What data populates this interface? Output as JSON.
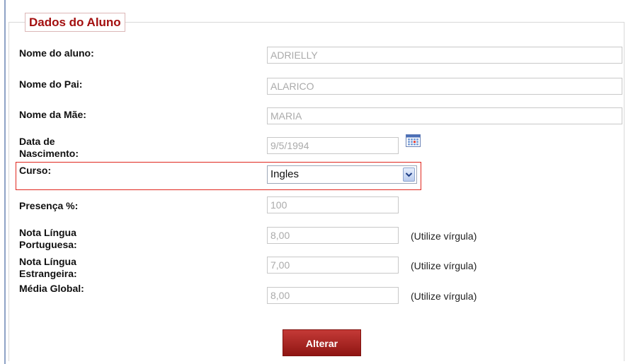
{
  "form": {
    "legend": "Dados do Aluno",
    "fields": {
      "nome_aluno": {
        "label": "Nome do aluno:",
        "value": "ADRIELLY"
      },
      "nome_pai": {
        "label": "Nome do Pai:",
        "value": "ALARICO"
      },
      "nome_mae": {
        "label": "Nome da Mãe:",
        "value": "MARIA"
      },
      "data_nascimento": {
        "label_line1": "Data de",
        "label_line2": "Nascimento:",
        "value": "9/5/1994",
        "icon": "calendar-icon"
      },
      "curso": {
        "label": "Curso:",
        "value": "Ingles",
        "icon": "chevron-down-icon"
      },
      "presenca": {
        "label": "Presença %:",
        "value": "100"
      },
      "nota_portuguesa": {
        "label_line1": "Nota Língua",
        "label_line2": "Portuguesa:",
        "value": "8,00",
        "hint": "(Utilize vírgula)"
      },
      "nota_estrangeira": {
        "label_line1": "Nota Língua",
        "label_line2": "Estrangeira:",
        "value": "7,00",
        "hint": "(Utilize vírgula)"
      },
      "media_global": {
        "label": "Média Global:",
        "value": "8,00",
        "hint": "(Utilize vírgula)"
      }
    },
    "submit_label": "Alterar",
    "highlight_color": "#e0271f",
    "accent_color": "#a30f0f"
  }
}
